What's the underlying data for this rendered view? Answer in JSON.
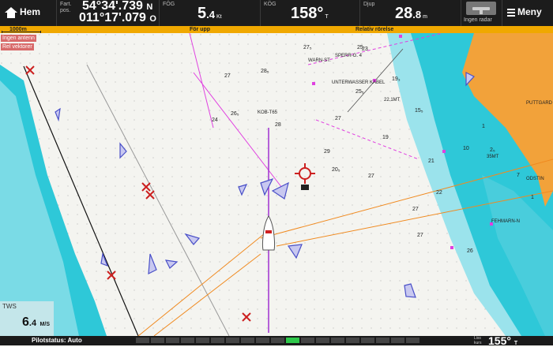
{
  "header": {
    "home_label": "Hem",
    "pos_label": "Fart.\npos.",
    "lat": "54°34'.739",
    "lat_hemi": "N",
    "lon": "011°17'.079",
    "lon_hemi": "O",
    "fog_label": "FÖG",
    "fog_value": "5",
    "fog_decimal": ".4",
    "fog_unit": "Kt",
    "kog_label": "KÖG",
    "kog_value": "158°",
    "kog_unit": "T",
    "depth_label": "Djup",
    "depth_value": "28",
    "depth_decimal": ".8",
    "depth_unit": "m",
    "radar_label": "Ingen radar",
    "menu_label": "Meny"
  },
  "subbar": {
    "scale": "1000m",
    "orientation": "För upp",
    "motion": "Relativ rörelse"
  },
  "overlays": {
    "no_antenna": "Ingen antenn",
    "rel_vectors": "Rel vektorer"
  },
  "tws": {
    "label": "TWS",
    "value": "6",
    "decimal": ".4",
    "unit": "M/S"
  },
  "bottom": {
    "pilot_status": "Pilotstatus: Auto",
    "list_label": "Liss\nkurs",
    "heading": "155°",
    "heading_unit": "T"
  },
  "chart": {
    "depths": [
      "27₅",
      "28₅",
      "23",
      "19₃",
      "25₅",
      "28",
      "26₅",
      "27",
      "29",
      "15₅",
      "21",
      "20₅",
      "27",
      "22",
      "27",
      "27",
      "26",
      "10",
      "1",
      "7",
      "2₅",
      "1",
      "19",
      "25",
      "24",
      "27"
    ],
    "labels": [
      "WARN-ST.",
      "SPERR-G. 4",
      "UNTERWASSER\nKABEL",
      "KOB-T65",
      "PUTTGARD",
      "ODSTIN",
      "FEHMARN-N",
      "35MT",
      "22.1MT"
    ],
    "colors": {
      "deep_water": "#f4f4f0",
      "shallow_water": "#2ec8d8",
      "mid_water": "#9be3ec",
      "land": "#f2a23a",
      "route_orange": "#f08a20",
      "magenta": "#e040e0",
      "ais_blue": "#4a50c8",
      "hazard_red": "#cc2020"
    }
  },
  "bars": [
    0,
    0,
    0,
    0,
    0,
    0,
    0,
    0,
    0,
    0,
    1,
    0,
    0,
    0,
    0,
    0,
    0,
    0,
    0
  ]
}
